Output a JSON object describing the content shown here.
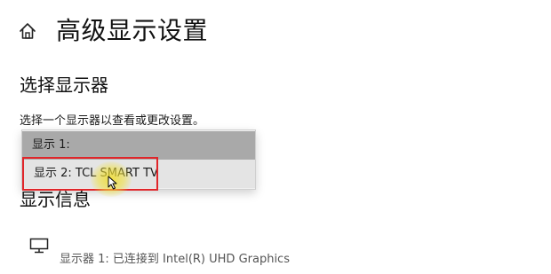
{
  "header": {
    "title": "高级显示设置",
    "home_icon": "home-icon"
  },
  "select_display": {
    "heading": "选择显示器",
    "hint": "选择一个显示器以查看或更改设置。",
    "options": [
      {
        "label": "显示 1:",
        "selected": true
      },
      {
        "label": "显示 2: TCL SMART TV",
        "hovered": true
      }
    ]
  },
  "display_info": {
    "heading": "显示信息",
    "monitor_icon": "monitor-icon",
    "monitor_line": "显示器 1: 已连接到 Intel(R) UHD Graphics"
  },
  "colors": {
    "highlight_border": "#e0262a",
    "selected_option_bg": "#a9a9a9",
    "hover_option_bg": "#e4e4e4",
    "cursor_glow": "#f0dc28"
  }
}
